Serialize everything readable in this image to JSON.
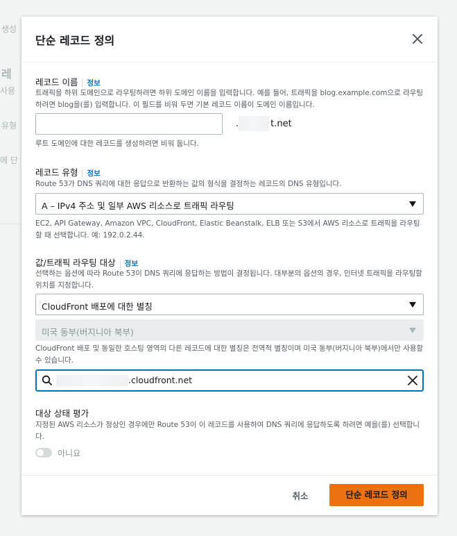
{
  "background": {
    "fragments": [
      "생성",
      "레",
      "사용",
      "유형",
      "에 단"
    ]
  },
  "modal": {
    "title": "단순 레코드 정의",
    "close_icon": "close-icon"
  },
  "record_name": {
    "label": "레코드 이름",
    "info": "정보",
    "description": "트래픽을 하위 도메인으로 라우팅하려면 하위 도메인 이름을 입력합니다. 예를 들어, 트래픽을 blog.example.com으로 라우팅하려면 blog을(를) 입력합니다. 이 필드를 비워 두면 기본 레코드 이름이 도메인 이름입니다.",
    "value": "",
    "domain_suffix": "t.net",
    "helper": "루트 도메인에 대한 레코드를 생성하려면 비워 둡니다."
  },
  "record_type": {
    "label": "레코드 유형",
    "info": "정보",
    "description": "Route 53가 DNS 쿼리에 대한 응답으로 반환하는 값의 형식을 결정하는 레코드의 DNS 유형입니다.",
    "selected": "A – IPv4 주소 및 일부 AWS 리소스로 트래픽 라우팅",
    "helper": "EC2, API Gateway, Amazon VPC, CloudFront, Elastic Beanstalk, ELB 또는 S3에서 AWS 리소스로 트래픽을 라우팅할 때 선택합니다. 예: 192.0.2.44."
  },
  "route_target": {
    "label": "값/트래픽 라우팅 대상",
    "info": "정보",
    "description": "선택하는 옵션에 따라 Route 53이 DNS 쿼리에 응답하는 방법이 결정됩니다. 대부분의 옵션의 경우, 인터넷 트래픽을 라우팅할 위치를 지정합니다.",
    "endpoint_selected": "CloudFront 배포에 대한 별칭",
    "region_selected": "미국 동부(버지니아 북부)",
    "helper": "CloudFront 배포 및 동일한 호스팅 영역의 다른 레코드에 대한 별칭은 전역적 별칭이며 미국 동부(버지니아 북부)에서만 사용할 수 있습니다.",
    "search_value": ".cloudfront.net",
    "search_icon": "search-icon",
    "clear_icon": "clear-icon"
  },
  "health": {
    "label": "대상 상태 평가",
    "description": "지정된 AWS 리소스가 정상인 경우에만 Route 53이 이 레코드를 사용하여 DNS 쿼리에 응답하도록 하려면 예을(를) 선택합니다.",
    "toggle_label": "아니요",
    "toggle_on": false
  },
  "footer": {
    "cancel": "취소",
    "submit": "단순 레코드 정의"
  },
  "colors": {
    "accent": "#0073bb",
    "primary_button": "#ec7211",
    "text": "#16191f",
    "muted": "#545b64"
  }
}
